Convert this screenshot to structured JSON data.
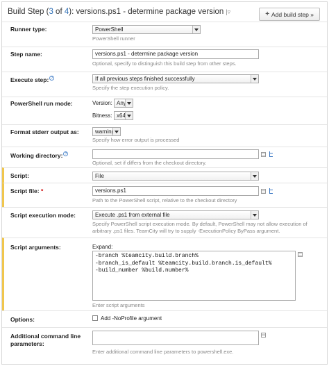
{
  "header": {
    "title_prefix": "Build Step (",
    "step_current": "3",
    "title_of": " of ",
    "step_total": "4",
    "title_suffix": "): versions.ps1 - determine package version",
    "dropdown_glyph": "|▿",
    "add_button_label": "Add build step »"
  },
  "runner_type": {
    "label": "Runner type:",
    "value": "PowerShell",
    "note": "PowerShell runner"
  },
  "step_name": {
    "label": "Step name:",
    "value": "versions.ps1 - determine package version",
    "note": "Optional, specify to distinguish this build step from other steps."
  },
  "execute_step": {
    "label": "Execute step:",
    "value": "If all previous steps finished successfully",
    "note": "Specify the step execution policy."
  },
  "run_mode": {
    "label": "PowerShell run mode:",
    "version_label": "Version:",
    "version_value": "Any",
    "bitness_label": "Bitness:",
    "bitness_value": "x64"
  },
  "stderr": {
    "label": "Format stderr output as:",
    "value": "warning",
    "note": "Specify how error output is processed"
  },
  "working_dir": {
    "label": "Working directory:",
    "value": "",
    "note": "Optional, set if differs from the checkout directory."
  },
  "script": {
    "label": "Script:",
    "value": "File"
  },
  "script_file": {
    "label": "Script file:",
    "required_mark": "*",
    "value": "versions.ps1",
    "note": "Path to the PowerShell script, relative to the checkout directory"
  },
  "exec_mode": {
    "label": "Script execution mode:",
    "value": "Execute .ps1 from external file",
    "note_line1": "Specify PowerShell script execution mode. By default, PowerShell may not allow execution of",
    "note_line2": "arbitrary .ps1 files. TeamCity will try to supply -ExecutionPolicy ByPass argument."
  },
  "script_args": {
    "label": "Script arguments:",
    "expand_label": "Expand:",
    "value": "-branch %teamcity.build.branch%\n-branch_is_default %teamcity.build.branch.is_default%\n-build_number %build.number%",
    "note": "Enter script arguments"
  },
  "options": {
    "label": "Options:",
    "noprofile_label": "Add -NoProfile argument"
  },
  "additional": {
    "label_line1": "Additional command line",
    "label_line2": "parameters:",
    "value": "",
    "note": "Enter additional command line parameters to powershell.exe."
  }
}
